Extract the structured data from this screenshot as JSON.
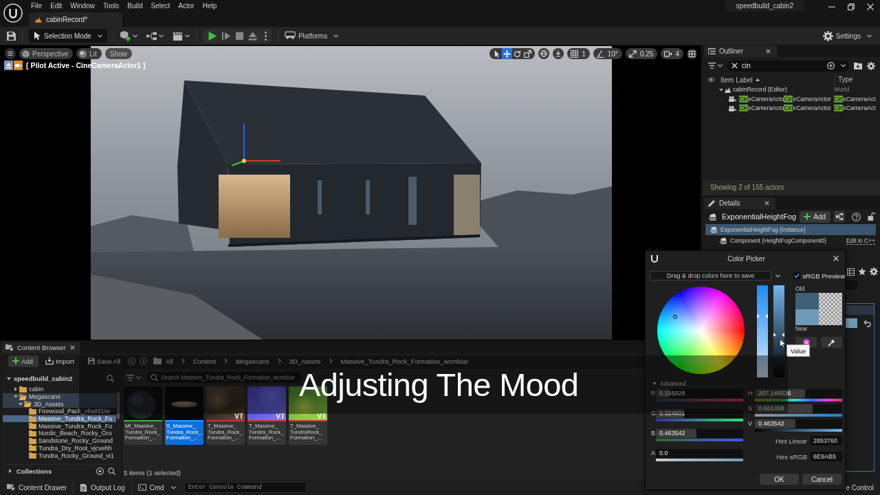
{
  "title_bar": {
    "menus": [
      "File",
      "Edit",
      "Window",
      "Tools",
      "Build",
      "Select",
      "Actor",
      "Help"
    ],
    "level_tab": "cabinRecord*",
    "project": "speedbuild_cabin2"
  },
  "toolbar": {
    "mode": "Selection Mode",
    "platforms": "Platforms",
    "settings": "Settings"
  },
  "viewport": {
    "view_buttons": [
      {
        "kind": "projection",
        "label": "Perspective"
      },
      {
        "kind": "lighting",
        "label": "Lit"
      },
      {
        "kind": "show",
        "label": "Show"
      }
    ],
    "pilot_label": "[ Pilot Active - CineCameraActor1 ]",
    "transform_tools": [
      {
        "kind": "select",
        "selected": false
      },
      {
        "kind": "move",
        "selected": true
      },
      {
        "kind": "rotate",
        "selected": false
      },
      {
        "kind": "scale",
        "selected": false
      }
    ],
    "snaps": [
      {
        "kind": "grid",
        "value": "1"
      },
      {
        "kind": "angle",
        "value": "10°"
      },
      {
        "kind": "scale",
        "value": "0.25"
      },
      {
        "kind": "camera",
        "value": "4"
      }
    ]
  },
  "outliner": {
    "title": "Outliner",
    "search": "cin",
    "columns": [
      "Item Label",
      "Type"
    ],
    "tree": [
      {
        "kind": "world",
        "label": [
          {
            "text": "cabinRecord (Editor)",
            "match": false
          }
        ],
        "type": [
          {
            "text": "World",
            "match": false
          }
        ],
        "expanded": true,
        "children": [
          {
            "kind": "camera",
            "label": [
              {
                "text": "Cin",
                "match": true
              },
              {
                "text": "eCameraActo",
                "match": false
              },
              {
                "text": "Cin",
                "match": true
              },
              {
                "text": "eCameraActor",
                "match": false
              }
            ],
            "type": [
              {
                "text": "Cin",
                "match": true
              },
              {
                "text": "eCameraAct",
                "match": false
              }
            ]
          },
          {
            "kind": "camera",
            "label": [
              {
                "text": "Cin",
                "match": true
              },
              {
                "text": "eCameraActo",
                "match": false
              },
              {
                "text": "Cin",
                "match": true
              },
              {
                "text": "eCameraActor",
                "match": false
              }
            ],
            "type": [
              {
                "text": "Cin",
                "match": true
              },
              {
                "text": "eCameraAct",
                "match": false
              }
            ]
          }
        ]
      }
    ],
    "status": "Showing 2 of 155 actors"
  },
  "details": {
    "title": "Details",
    "actor": "ExponentialHeightFog",
    "add_button": "Add",
    "components": [
      {
        "label": "ExponentialHeightFog (Instance)",
        "selected": true,
        "children": [
          {
            "label": "Component (HeightFogComponent0)",
            "selected": false,
            "link": "Edit in C++"
          }
        ]
      }
    ]
  },
  "content_browser": {
    "title": "Content Browser",
    "add_button": "Add",
    "import_button": "Import",
    "save_all": "Save All",
    "path": [
      "All",
      "Content",
      "Megascans",
      "3D_Assets",
      "Massive_Tundra_Rock_Formation_wcmbiar"
    ],
    "search_placeholder": "Search Massive_Tundra_Rock_Formation_wcmbiar",
    "tree": {
      "label": "speedbuild_cabin2",
      "expanded": true,
      "children": [
        {
          "label": "cabin",
          "expanded": false,
          "selected": false,
          "highlighted": false
        },
        {
          "label": "Megascans",
          "expanded": true,
          "selected": false,
          "highlighted": true,
          "children": [
            {
              "label": "3D_Assets",
              "expanded": true,
              "selected": false,
              "highlighted": true,
              "children": [
                {
                  "label": "Firewood_Pack_vbwhf1iw",
                  "selected": false,
                  "highlighted": false
                },
                {
                  "label": "Massive_Tundra_Rock_Fo",
                  "selected": true,
                  "highlighted": false
                },
                {
                  "label": "Massive_Tundra_Rock_Fo",
                  "selected": false,
                  "highlighted": false
                },
                {
                  "label": "Nordic_Beach_Rocky_Gro",
                  "selected": false,
                  "highlighted": false
                },
                {
                  "label": "Sandstone_Rocky_Ground",
                  "selected": false,
                  "highlighted": false
                },
                {
                  "label": "Tundra_Dry_Root_vjcvehh",
                  "selected": false,
                  "highlighted": false
                },
                {
                  "label": "Tundra_Rocky_Ground_vi1",
                  "selected": false,
                  "highlighted": false
                }
              ]
            }
          ]
        }
      ]
    },
    "collections": "Collections",
    "assets": [
      {
        "kind": "material",
        "label_lines": [
          "MI_Massive_",
          "Tundra_Rock_",
          "Formation_..."
        ],
        "color": "#3fae4a",
        "selected": false
      },
      {
        "kind": "mesh",
        "label_lines": [
          "S_Massive_",
          "Tundra_Rock_",
          "Formation_..."
        ],
        "color": "#2b9bff",
        "selected": true
      },
      {
        "kind": "texture",
        "label_lines": [
          "T_Massive_",
          "Tundra_Rock_",
          "Formation_..."
        ],
        "color": "#c23a3a",
        "badge": "VT",
        "selected": false
      },
      {
        "kind": "texture",
        "label_lines": [
          "T_Massive_",
          "Tundra_Rock_",
          "Formation_..."
        ],
        "color": "#c23a3a",
        "badge": "VT",
        "selected": false
      },
      {
        "kind": "texture",
        "label_lines": [
          "T_Massive_",
          "TundraRock_",
          "Formation_..."
        ],
        "color": "#c23a3a",
        "badge": "VT",
        "selected": false
      }
    ],
    "status": "5 items (1 selected)"
  },
  "status_bar": {
    "content_drawer": "Content Drawer",
    "output_log": "Output Log",
    "cmd": "Cmd",
    "console_placeholder": "Enter Console Command",
    "source_control": "e Control"
  },
  "color_picker": {
    "title": "Color Picker",
    "drop_hint": "Drag & drop colors here to save",
    "srgb_preview": {
      "label": "sRGB Preview",
      "checked": true
    },
    "swatches": [
      {
        "label": "Old",
        "color": "#3f6075"
      },
      {
        "label": "New",
        "color": "#6e9ab5"
      }
    ],
    "tooltip": "Value",
    "advanced": {
      "label": "Advanced",
      "expanded": true
    },
    "rgba_sliders": [
      {
        "kind": "red",
        "label": "R",
        "value": "0.156928",
        "level": 0.157
      },
      {
        "kind": "green",
        "label": "G",
        "value": "0.324801",
        "level": 0.325
      },
      {
        "kind": "blue",
        "label": "B",
        "value": "0.463542",
        "level": 0.464
      },
      {
        "kind": "alpha",
        "label": "A",
        "value": "0.0",
        "level": 0
      }
    ],
    "hsv_sliders": [
      {
        "kind": "hue",
        "label": "H",
        "value": "207.149536",
        "level": 0.575
      },
      {
        "kind": "saturation",
        "label": "S",
        "value": "0.661458",
        "level": 0.661
      },
      {
        "kind": "value",
        "label": "V",
        "value": "0.463542",
        "level": 0.464
      }
    ],
    "hex_fields": [
      {
        "label": "Hex Linear",
        "value": "2853760"
      },
      {
        "label": "Hex sRGB",
        "value": "6E9AB5"
      }
    ],
    "buttons": [
      "OK",
      "Cancel"
    ]
  },
  "title_overlay": "Adjusting The Mood"
}
